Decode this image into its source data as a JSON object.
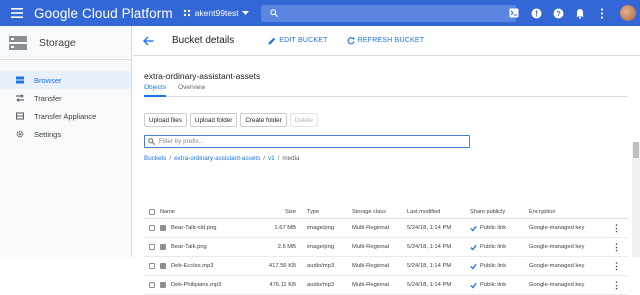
{
  "topbar": {
    "title": "Google Cloud Platform",
    "project": "akent99test",
    "search_placeholder": "",
    "icons": [
      "terminal-icon",
      "feedback-icon",
      "help-icon",
      "notifications-icon",
      "more-vert-icon",
      "avatar"
    ],
    "accent": "#3367d6"
  },
  "sidebar": {
    "title": "Storage",
    "items": [
      {
        "label": "Browser",
        "icon": "storage-bucket-icon",
        "active": true
      },
      {
        "label": "Transfer",
        "icon": "transfer-arrows-icon",
        "active": false
      },
      {
        "label": "Transfer Appliance",
        "icon": "appliance-icon",
        "active": false
      },
      {
        "label": "Settings",
        "icon": "gear-icon",
        "active": false
      }
    ]
  },
  "header": {
    "title": "Bucket details",
    "edit_label": "EDIT BUCKET",
    "refresh_label": "REFRESH BUCKET"
  },
  "bucket": {
    "name": "extra-ordinary-assistant-assets",
    "tabs": [
      {
        "label": "Objects",
        "active": true
      },
      {
        "label": "Overview",
        "active": false
      }
    ]
  },
  "toolbar": {
    "upload_files": "Upload files",
    "upload_folder": "Upload folder",
    "create_folder": "Create folder",
    "delete": "Delete"
  },
  "filter": {
    "placeholder": "Filter by prefix..."
  },
  "breadcrumb": {
    "root": "Buckets",
    "bucket": "extra-ordinary-assistant-assets",
    "v1": "v1",
    "media": "media"
  },
  "table": {
    "headers": {
      "name": "Name",
      "size": "Size",
      "type": "Type",
      "storage_class": "Storage class",
      "last_modified": "Last modified",
      "share": "Share publicly",
      "encryption": "Encryption"
    },
    "rows": [
      {
        "name": "Bear-Talk-old.png",
        "size": "1.67 MB",
        "type": "image/png",
        "storage_class": "Multi-Regional",
        "modified": "5/24/18, 1:14 PM",
        "share": "Public link",
        "encryption": "Google-managed key"
      },
      {
        "name": "Bear-Talk.png",
        "size": "2.5 MB",
        "type": "image/png",
        "storage_class": "Multi-Regional",
        "modified": "5/24/18, 1:14 PM",
        "share": "Public link",
        "encryption": "Google-managed key"
      },
      {
        "name": "Deb-Eccles.mp3",
        "size": "417.56 KB",
        "type": "audio/mp3",
        "storage_class": "Multi-Regional",
        "modified": "5/24/18, 1:14 PM",
        "share": "Public link",
        "encryption": "Google-managed key"
      },
      {
        "name": "Deb-Philipians.mp3",
        "size": "476.11 KB",
        "type": "audio/mp3",
        "storage_class": "Multi-Regional",
        "modified": "5/24/18, 1:14 PM",
        "share": "Public link",
        "encryption": "Google-managed key"
      }
    ]
  }
}
